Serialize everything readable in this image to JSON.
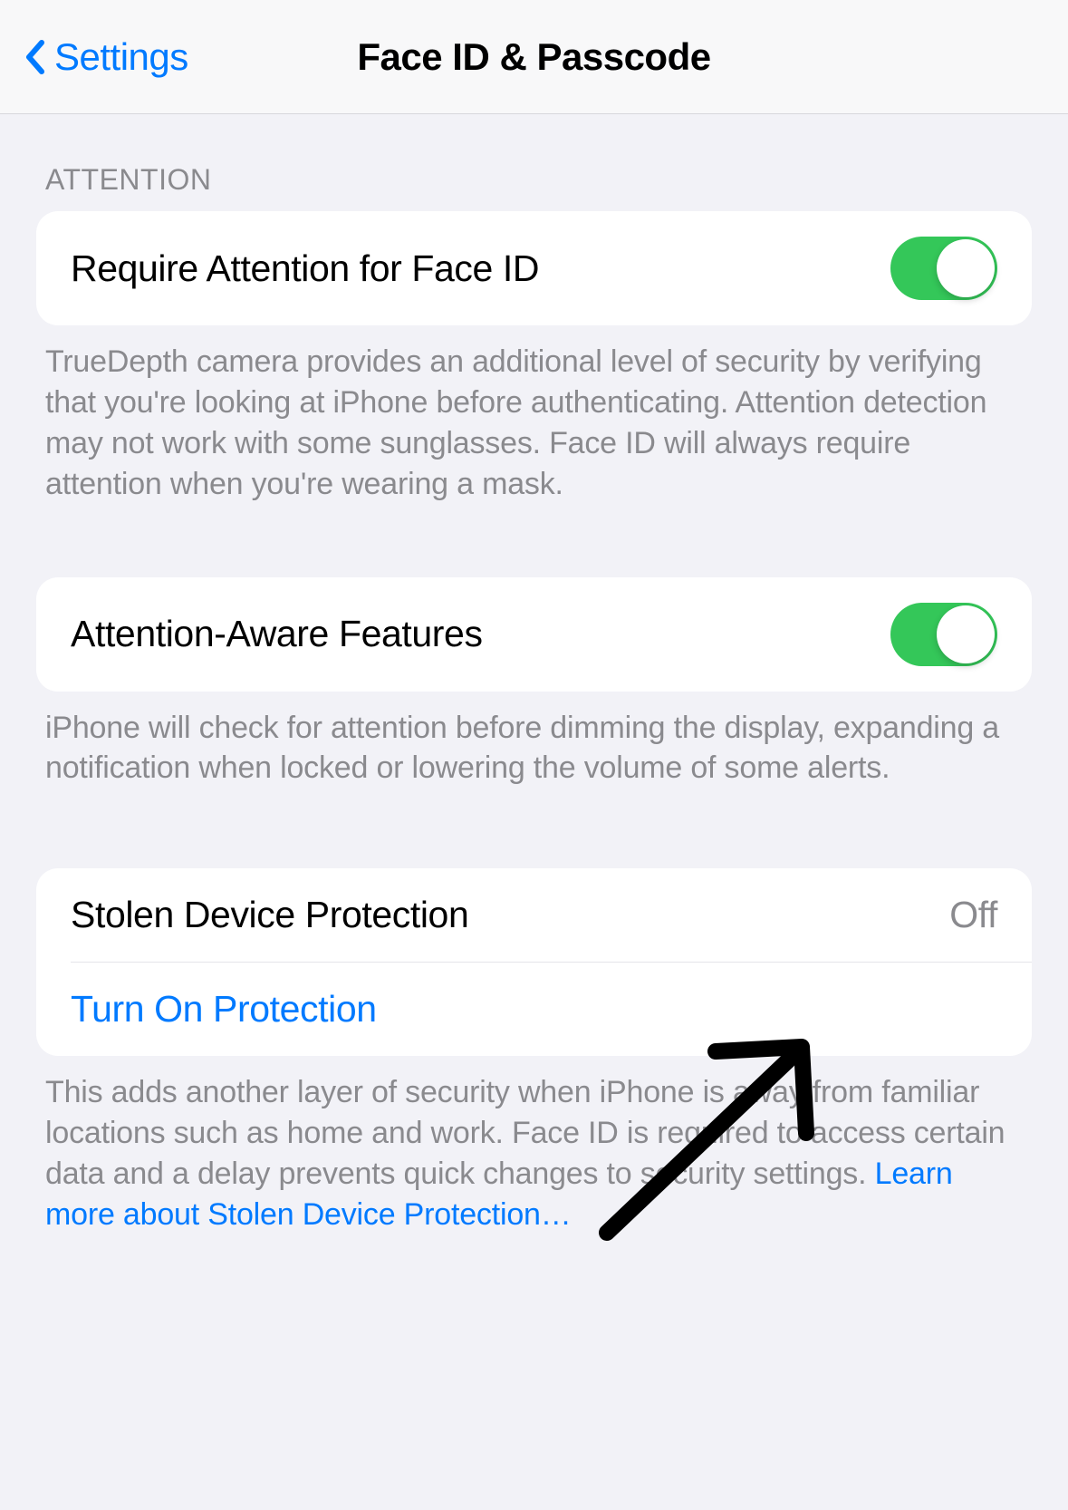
{
  "nav": {
    "back_label": "Settings",
    "title": "Face ID & Passcode"
  },
  "sections": {
    "attention": {
      "header": "ATTENTION",
      "require_attention": {
        "label": "Require Attention for Face ID",
        "enabled": true,
        "description": "TrueDepth camera provides an additional level of security by verifying that you're looking at iPhone before authenticating. Attention detection may not work with some sunglasses. Face ID will always require attention when you're wearing a mask."
      },
      "attention_aware": {
        "label": "Attention-Aware Features",
        "enabled": true,
        "description": "iPhone will check for attention before dimming the display, expanding a notification when locked or lowering the volume of some alerts."
      }
    },
    "stolen_device": {
      "status_label": "Stolen Device Protection",
      "status_value": "Off",
      "action_label": "Turn On Protection",
      "description_prefix": "This adds another layer of security when iPhone is away from familiar locations such as home and work. Face ID is required to access certain data and a delay prevents quick changes to security settings. ",
      "learn_more": "Learn more about Stolen Device Protection…"
    }
  }
}
